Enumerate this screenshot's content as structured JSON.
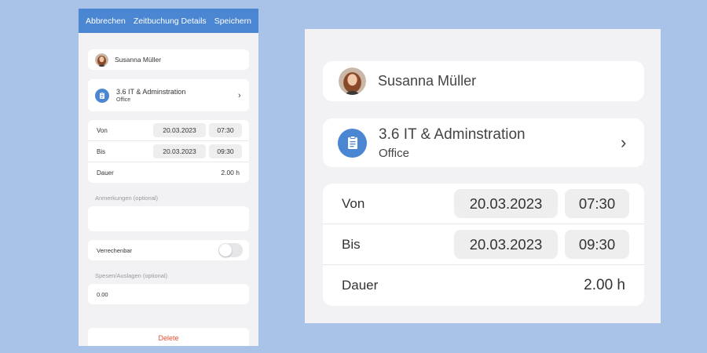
{
  "navbar": {
    "cancel_label": "Abbrechen",
    "title": "Zeitbuchung Details",
    "save_label": "Speichern"
  },
  "user": {
    "name": "Susanna Müller"
  },
  "project": {
    "title": "3.6 IT & Adminstration",
    "subtitle": "Office",
    "icon": "clipboard-icon"
  },
  "time": {
    "from_label": "Von",
    "from_date": "20.03.2023",
    "from_time": "07:30",
    "to_label": "Bis",
    "to_date": "20.03.2023",
    "to_time": "09:30",
    "duration_label": "Dauer",
    "duration_value": "2.00 h"
  },
  "notes": {
    "label": "Anmerkungen (optional)",
    "value": ""
  },
  "billable": {
    "label": "Verrechenbar",
    "on": false
  },
  "expenses": {
    "label": "Spesen/Auslagen (optional)",
    "value": "0.00"
  },
  "delete_label": "Delete",
  "colors": {
    "accent": "#4b86d2",
    "background": "#a9c3e8",
    "delete": "#e5502f"
  }
}
